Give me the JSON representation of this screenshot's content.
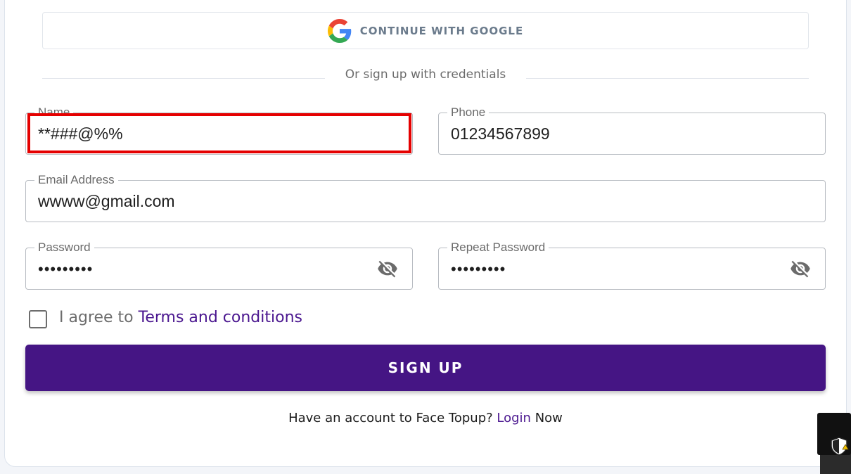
{
  "google": {
    "label": "CONTINUE WITH GOOGLE",
    "icon": "google-g-icon"
  },
  "divider": {
    "text": "Or sign up with credentials"
  },
  "fields": {
    "name": {
      "label": "Name",
      "value": "**###@%%"
    },
    "phone": {
      "label": "Phone",
      "value": "01234567899"
    },
    "email": {
      "label": "Email Address",
      "value": "wwww@gmail.com"
    },
    "password": {
      "label": "Password",
      "value": "•••••••••",
      "icon": "eye-off-icon"
    },
    "repeat_password": {
      "label": "Repeat Password",
      "value": "•••••••••",
      "icon": "eye-off-icon"
    }
  },
  "terms": {
    "prefix": "I agree to ",
    "link": "Terms and conditions",
    "checked": false
  },
  "signup": {
    "label": "SIGN UP"
  },
  "footer": {
    "prefix": "Have an account to Face Topup? ",
    "link": "Login",
    "suffix": " Now"
  },
  "colors": {
    "primary": "#451584",
    "link": "#4a168f",
    "error_highlight": "#e50000"
  },
  "os": {
    "icon": "security-shield-icon"
  }
}
